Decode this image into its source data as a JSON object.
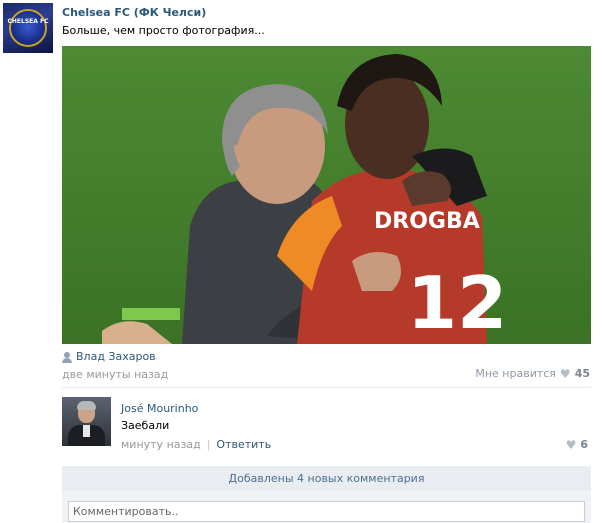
{
  "post": {
    "group_name": "Chelsea FC (ФК Челси)",
    "text": "Больше, чем просто фотография...",
    "group_avatar_text": "CHELSEA FC",
    "author": "Влад Захаров",
    "time": "две минуты назад",
    "likes_label": "Мне нравится",
    "likes_count": "45",
    "photo_overlay_text": "DROGBA",
    "photo_number": "12"
  },
  "comment": {
    "author": "José Mourinho",
    "text": "Заебали",
    "time": "минуту назад",
    "reply_label": "Ответить",
    "likes": "6"
  },
  "new_comments_label": "Добавлены 4 новых комментария",
  "reply_placeholder": "Комментировать..",
  "colors": {
    "link": "#2b587a",
    "meta": "#999999",
    "banner_bg": "#e9edf1"
  }
}
